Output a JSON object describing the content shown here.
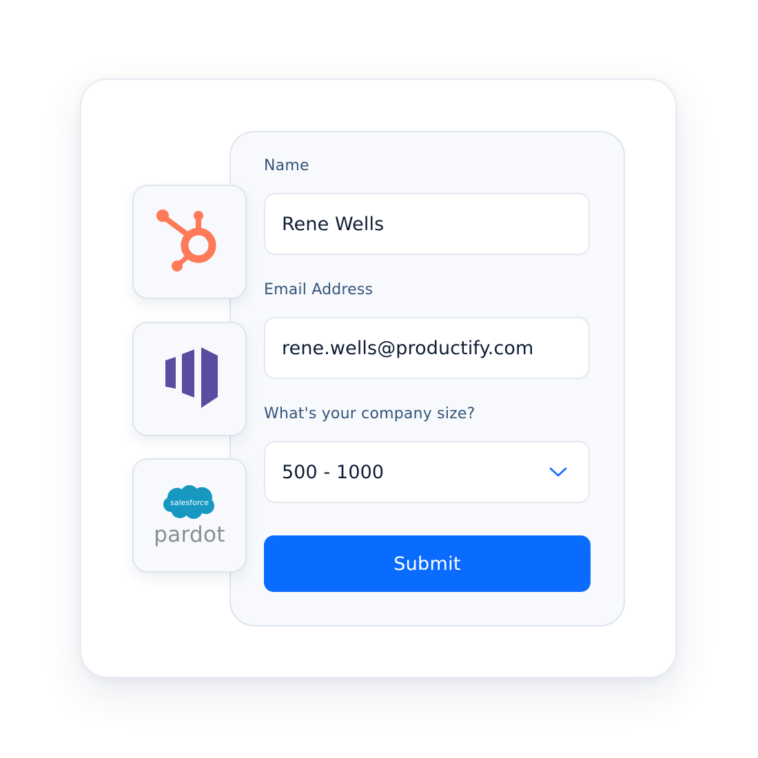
{
  "form": {
    "name_label": "Name",
    "name_value": "Rene Wells",
    "email_label": "Email Address",
    "email_value": "rene.wells@productify.com",
    "company_size_label": "What's your company size?",
    "company_size_value": "500 - 1000",
    "submit_label": "Submit"
  },
  "integrations": [
    {
      "icon": "hubspot-icon"
    },
    {
      "icon": "marketo-icon"
    },
    {
      "icon": "salesforce-icon",
      "badge": "salesforce",
      "name": "pardot"
    }
  ],
  "colors": {
    "accent": "#0a6cff",
    "hubspot": "#ff7a59",
    "marketo": "#5c4c9f",
    "salesforce": "#1798c1",
    "label": "#33557a",
    "value": "#0f1d35"
  }
}
